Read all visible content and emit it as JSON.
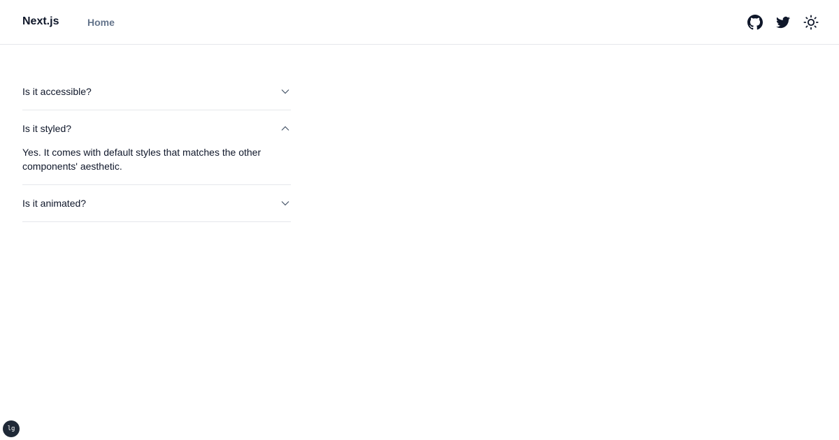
{
  "header": {
    "brand": "Next.js",
    "nav": [
      {
        "label": "Home"
      }
    ],
    "icons": [
      "github-icon",
      "twitter-icon",
      "sun-icon"
    ]
  },
  "accordion": {
    "items": [
      {
        "question": "Is it accessible?",
        "expanded": false,
        "answer": ""
      },
      {
        "question": "Is it styled?",
        "expanded": true,
        "answer": "Yes. It comes with default styles that matches the other components' aesthetic."
      },
      {
        "question": "Is it animated?",
        "expanded": false,
        "answer": ""
      }
    ]
  },
  "badge": {
    "label": "lg"
  },
  "colors": {
    "text": "#0f172a",
    "muted": "#64748b",
    "border": "#e5e7eb"
  }
}
